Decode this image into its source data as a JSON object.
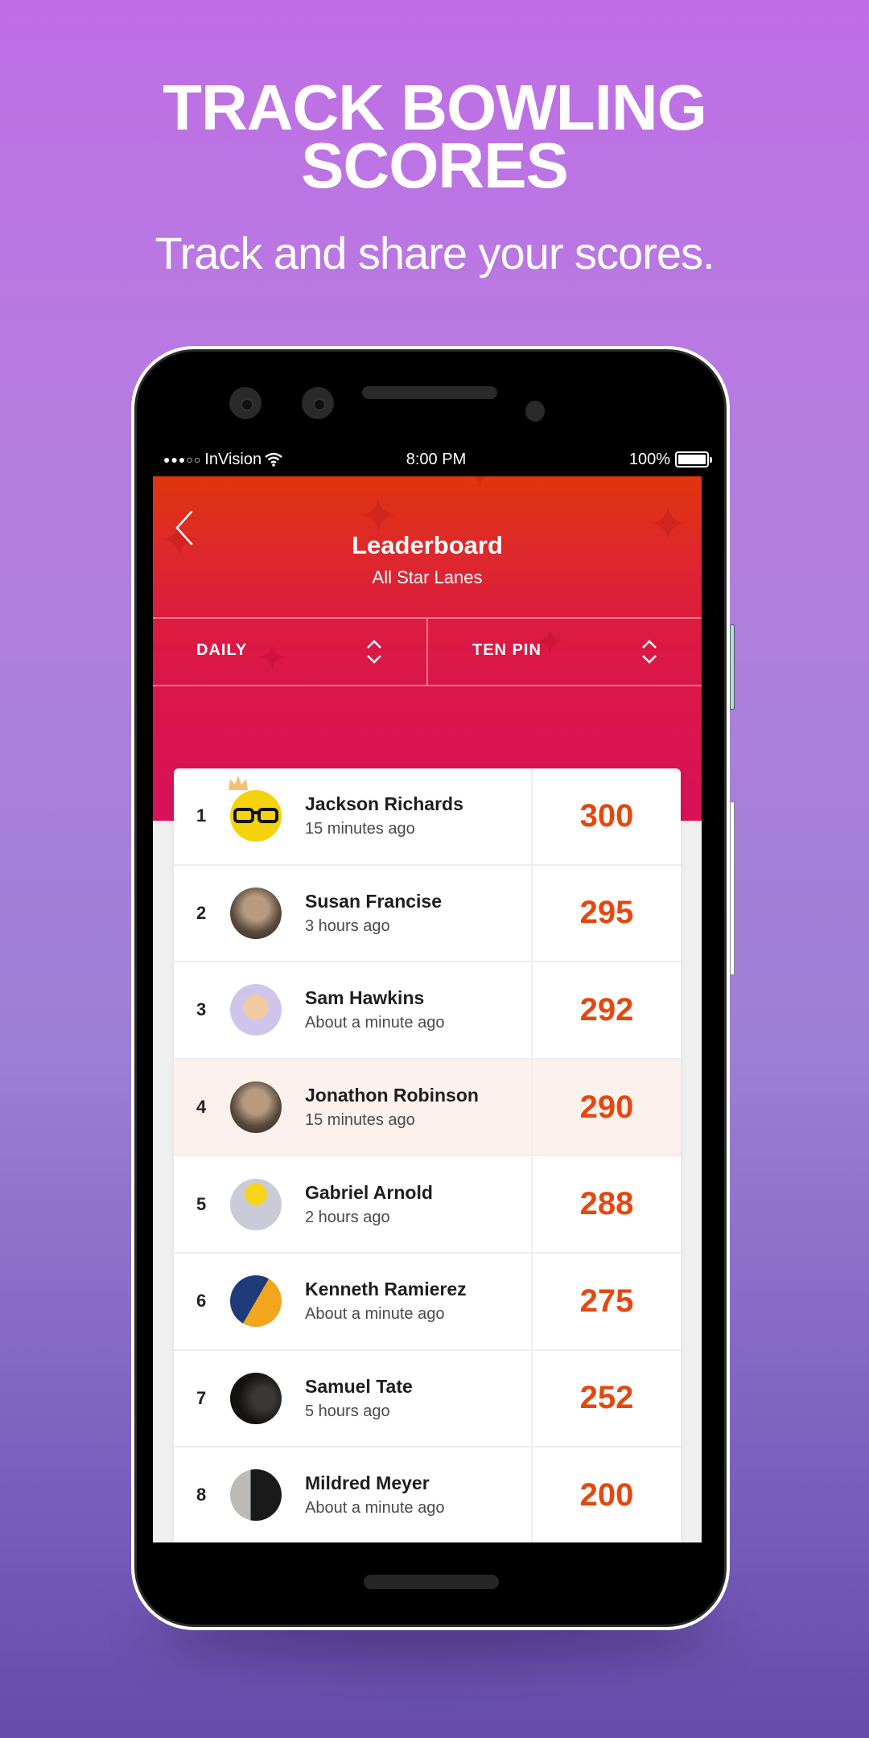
{
  "hero": {
    "title_line1": "TRACK BOWLING",
    "title_line2": "SCORES",
    "subtitle": "Track and share your scores."
  },
  "status_bar": {
    "carrier": "InVision",
    "signal_dots": "●●●○○",
    "time": "8:00 PM",
    "battery_percent": "100%",
    "battery_level": 1.0
  },
  "header": {
    "title": "Leaderboard",
    "subtitle": "All Star Lanes",
    "back_icon": "chevron-left-icon"
  },
  "filters": [
    {
      "label": "DAILY",
      "icon": "sort-updown-icon"
    },
    {
      "label": "TEN PIN",
      "icon": "sort-updown-icon"
    }
  ],
  "colors": {
    "score": "#e5480f",
    "header_top": "#e0360d",
    "header_bottom": "#d8115a",
    "highlight_row": "#fdf1ee",
    "crown": "#f2c27a"
  },
  "leaderboard": [
    {
      "rank": "1",
      "name": "Jackson Richards",
      "time": "15 minutes ago",
      "score": "300",
      "avatar": "yellow-glasses-avatar",
      "crown": true
    },
    {
      "rank": "2",
      "name": "Susan Francise",
      "time": "3 hours ago",
      "score": "295",
      "avatar": "photo-avatar"
    },
    {
      "rank": "3",
      "name": "Sam Hawkins",
      "time": "About a minute ago",
      "score": "292",
      "avatar": "lego-avatar"
    },
    {
      "rank": "4",
      "name": "Jonathon Robinson",
      "time": "15 minutes ago",
      "score": "290",
      "avatar": "photo-avatar",
      "highlight": true
    },
    {
      "rank": "5",
      "name": "Gabriel Arnold",
      "time": "2 hours ago",
      "score": "288",
      "avatar": "lego-head-avatar"
    },
    {
      "rank": "6",
      "name": "Kenneth Ramierez",
      "time": "About a minute ago",
      "score": "275",
      "avatar": "yin-yang-avatar"
    },
    {
      "rank": "7",
      "name": "Samuel Tate",
      "time": "5 hours ago",
      "score": "252",
      "avatar": "dark-photo-avatar"
    },
    {
      "rank": "8",
      "name": "Mildred Meyer",
      "time": "About a minute ago",
      "score": "200",
      "avatar": "masked-avatar"
    }
  ]
}
